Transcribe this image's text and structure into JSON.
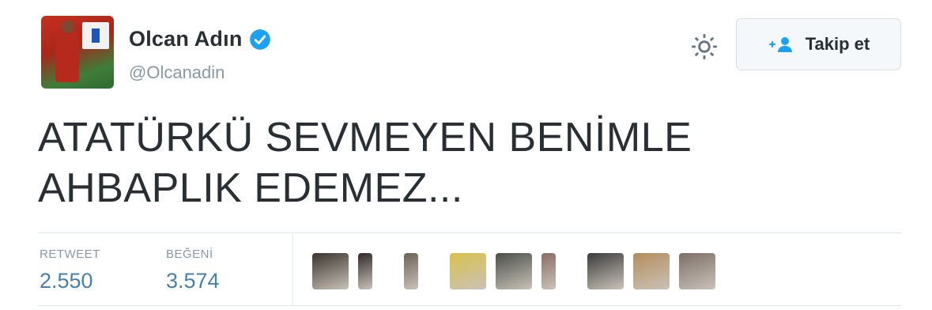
{
  "profile": {
    "display_name": "Olcan Adın",
    "handle": "@Olcanadin"
  },
  "actions": {
    "follow_label": "Takip et"
  },
  "tweet": {
    "lines": [
      "ATATÜRKÜ SEVMEYEN BENİMLE",
      "AHBAPLIK EDEMEZ..."
    ]
  },
  "stats": {
    "retweet_label": "RETWEET",
    "retweet_count": "2.550",
    "like_label": "BEĞENİ",
    "like_count": "3.574"
  },
  "likers": [
    {
      "name": "liker-avatar-1",
      "color": "#3b332d"
    },
    {
      "name": "liker-avatar-2",
      "color": "#2e2a28"
    },
    {
      "name": "liker-avatar-3",
      "color": "#6b6258"
    },
    {
      "name": "liker-avatar-4",
      "color": "#d9c24a"
    },
    {
      "name": "liker-avatar-5",
      "color": "#4a4f48"
    },
    {
      "name": "liker-avatar-6",
      "color": "#8a6e66"
    },
    {
      "name": "liker-avatar-7",
      "color": "#3c3c3c"
    },
    {
      "name": "liker-avatar-8",
      "color": "#b58d5c"
    },
    {
      "name": "liker-avatar-9",
      "color": "#7d6f68"
    }
  ],
  "colors": {
    "verified_badge": "#1da1f2",
    "stat_value": "#4a7fa8",
    "follow_icon": "#1da1f2"
  }
}
